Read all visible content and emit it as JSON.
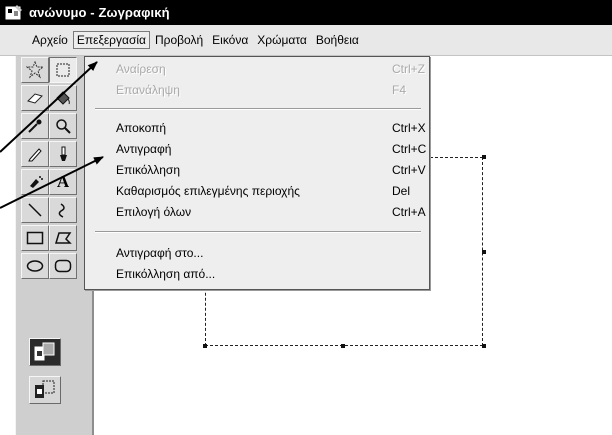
{
  "window": {
    "title": "ανώνυμο - Ζωγραφική",
    "icon": "paint-app-icon"
  },
  "menubar": {
    "items": [
      {
        "label": "Αρχείο",
        "active": false
      },
      {
        "label": "Επεξεργασία",
        "active": true
      },
      {
        "label": "Προβολή",
        "active": false
      },
      {
        "label": "Εικόνα",
        "active": false
      },
      {
        "label": "Χρώματα",
        "active": false
      },
      {
        "label": "Βοήθεια",
        "active": false
      }
    ]
  },
  "edit_menu": {
    "items": [
      {
        "label": "Αναίρεση",
        "shortcut": "Ctrl+Z",
        "enabled": false
      },
      {
        "label": "Επανάληψη",
        "shortcut": "F4",
        "enabled": false
      },
      {
        "label": "Αποκοπή",
        "shortcut": "Ctrl+X",
        "enabled": true
      },
      {
        "label": "Αντιγραφή",
        "shortcut": "Ctrl+C",
        "enabled": true
      },
      {
        "label": "Επικόλληση",
        "shortcut": "Ctrl+V",
        "enabled": true
      },
      {
        "label": "Καθαρισμός επιλεγμένης περιοχής",
        "shortcut": "Del",
        "enabled": true
      },
      {
        "label": "Επιλογή όλων",
        "shortcut": "Ctrl+A",
        "enabled": true
      },
      {
        "label": "Αντιγραφή στο...",
        "shortcut": "",
        "enabled": true
      },
      {
        "label": "Επικόλληση από...",
        "shortcut": "",
        "enabled": true
      }
    ]
  },
  "toolbox": {
    "tools": [
      {
        "name": "free-form-select-icon"
      },
      {
        "name": "rectangle-select-icon"
      },
      {
        "name": "eraser-icon"
      },
      {
        "name": "fill-bucket-icon"
      },
      {
        "name": "color-picker-icon"
      },
      {
        "name": "magnifier-icon"
      },
      {
        "name": "pencil-icon"
      },
      {
        "name": "brush-icon"
      },
      {
        "name": "airbrush-icon"
      },
      {
        "name": "text-tool-icon"
      },
      {
        "name": "line-icon"
      },
      {
        "name": "curve-icon"
      },
      {
        "name": "rectangle-icon"
      },
      {
        "name": "polygon-icon"
      },
      {
        "name": "ellipse-icon"
      },
      {
        "name": "rounded-rectangle-icon"
      }
    ],
    "text_tool_glyph": "A",
    "options": [
      {
        "name": "opaque-selection-icon",
        "selected": true
      },
      {
        "name": "transparent-selection-icon",
        "selected": false
      }
    ]
  },
  "colors": {
    "title_bg": "#000000",
    "menu_bg": "#eeeeee",
    "toolbox_bg": "#cfcfcf",
    "canvas_bg": "#ffffff"
  }
}
